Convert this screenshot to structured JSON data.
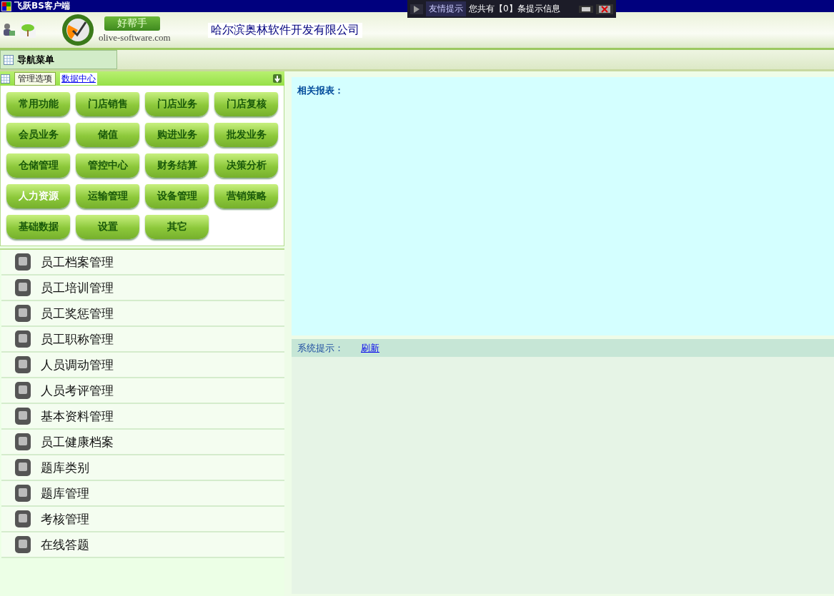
{
  "window": {
    "title": "飞跃BS客户端"
  },
  "notice": {
    "label": "友情提示",
    "message": "您共有【0】条提示信息"
  },
  "header": {
    "slogan": "好帮手",
    "domain": "olive-software.com",
    "company": "哈尔滨奥林软件开发有限公司"
  },
  "nav": {
    "title": "导航菜单"
  },
  "panel": {
    "tabs": [
      {
        "label": "管理选项",
        "kind": "tab",
        "selected": true
      },
      {
        "label": "数据中心",
        "kind": "link",
        "selected": false
      }
    ]
  },
  "modules": [
    {
      "label": "常用功能",
      "selected": false
    },
    {
      "label": "门店销售",
      "selected": false
    },
    {
      "label": "门店业务",
      "selected": false
    },
    {
      "label": "门店复核",
      "selected": false
    },
    {
      "label": "会员业务",
      "selected": false
    },
    {
      "label": "储值",
      "selected": false
    },
    {
      "label": "购进业务",
      "selected": false
    },
    {
      "label": "批发业务",
      "selected": false
    },
    {
      "label": "仓储管理",
      "selected": false
    },
    {
      "label": "管控中心",
      "selected": false
    },
    {
      "label": "财务结算",
      "selected": false
    },
    {
      "label": "决策分析",
      "selected": false
    },
    {
      "label": "人力资源",
      "selected": true
    },
    {
      "label": "运输管理",
      "selected": false
    },
    {
      "label": "设备管理",
      "selected": false
    },
    {
      "label": "营销策略",
      "selected": false
    },
    {
      "label": "基础数据",
      "selected": false
    },
    {
      "label": "设置",
      "selected": false
    },
    {
      "label": "其它",
      "selected": false
    }
  ],
  "menu_items": [
    "员工档案管理",
    "员工培训管理",
    "员工奖惩管理",
    "员工职称管理",
    "人员调动管理",
    "人员考评管理",
    "基本资料管理",
    "员工健康档案",
    "题库类别",
    "题库管理",
    "考核管理",
    "在线答题"
  ],
  "reports": {
    "title": "相关报表："
  },
  "system": {
    "label": "系统提示：",
    "link": "刷新"
  }
}
